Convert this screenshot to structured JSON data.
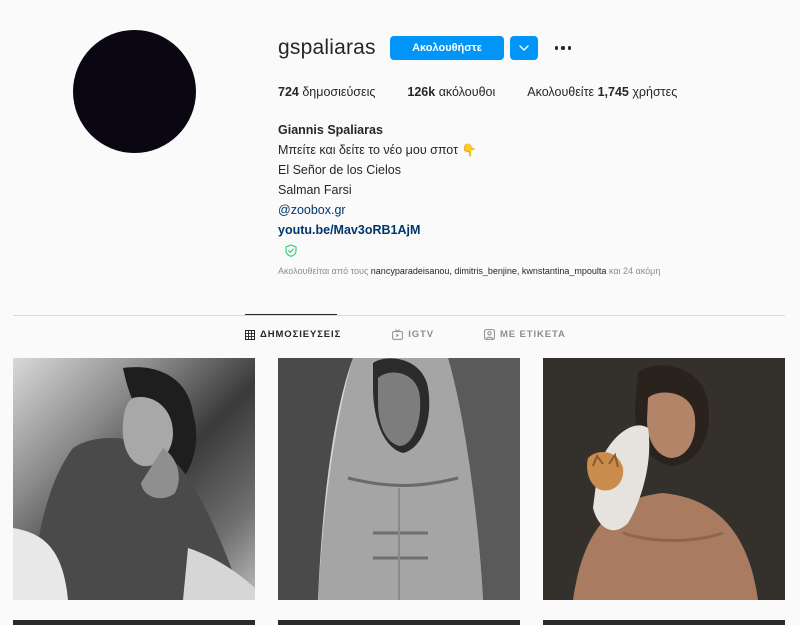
{
  "profile": {
    "username": "gspaliaras",
    "follow_label": "Ακολουθήστε",
    "stats": {
      "posts_count": "724",
      "posts_label": "δημοσιεύσεις",
      "followers_count": "126k",
      "followers_label": "ακόλουθοι",
      "following_prefix": "Ακολουθείτε",
      "following_count": "1,745",
      "following_suffix": "χρήστες"
    },
    "bio": {
      "full_name": "Giannis Spaliaras",
      "line1": "Μπείτε και δείτε το νέο μου σποτ",
      "line1_emoji": "👇",
      "line2": "El Señor de los Cielos",
      "line3": "Salman Farsi",
      "mention": "@zoobox.gr",
      "website": "youtu.be/Mav3oRB1AjM"
    },
    "followed_by": {
      "prefix": "Ακολουθείται από τους",
      "users": "nancyparadeisanou, dimitris_benjine, kwnstantina_mpoulta",
      "suffix": "και 24 ακόμη"
    }
  },
  "tabs": [
    {
      "label": "ΔΗΜΟΣΙΕΥΣΕΙΣ",
      "icon": "grid-icon",
      "active": true
    },
    {
      "label": "IGTV",
      "icon": "igtv-icon",
      "active": false
    },
    {
      "label": "ΜΕ ΕΤΙΚΕΤΑ",
      "icon": "tagged-icon",
      "active": false
    }
  ],
  "colors": {
    "accent": "#0095f6",
    "background": "#fafafa",
    "link": "#00376b",
    "muted": "#8e8e8e",
    "verified": "#2ecc71"
  }
}
